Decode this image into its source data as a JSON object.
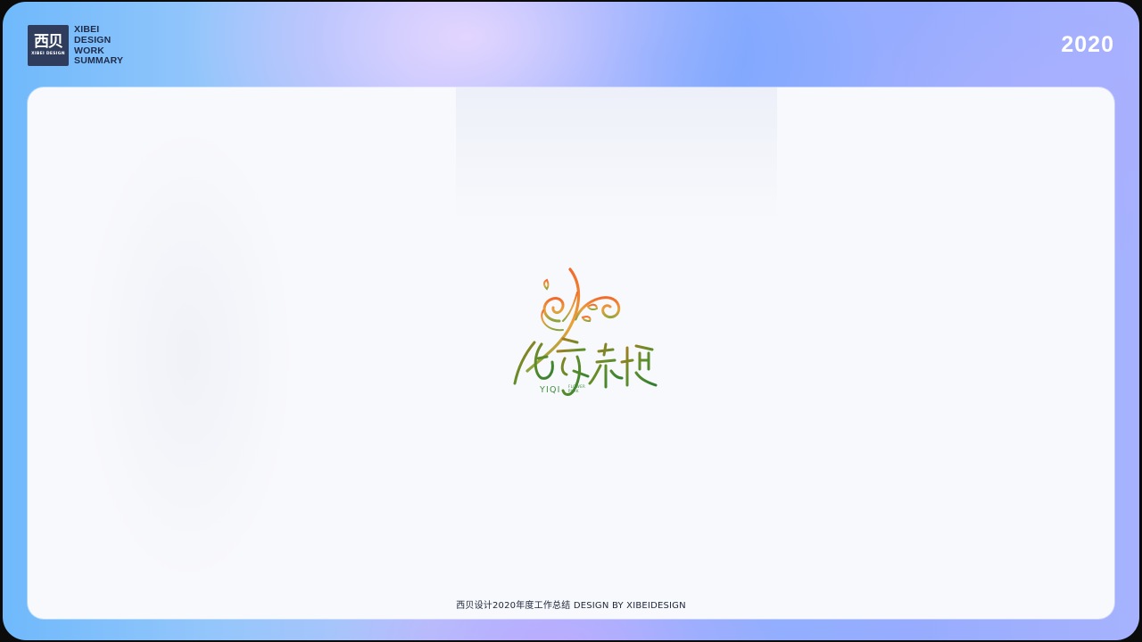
{
  "header": {
    "logo_glyph": "西贝",
    "logo_sub": "XIBEI DESIGN",
    "brand_lines": [
      "XIBEI",
      "DESIGN",
      "WORK",
      "SUMMARY"
    ],
    "year": "2020"
  },
  "emblem": {
    "chinese_name": "亿奇花境",
    "latin_name": "YIQI",
    "sub_line_1": "FLOWER",
    "sub_line_2": "PARK"
  },
  "footer": {
    "caption": "西贝设计2020年度工作总结 DESIGN BY XIBEIDESIGN"
  },
  "colors": {
    "emblem_orange": "#f07a2a",
    "emblem_green": "#2e7d32"
  }
}
